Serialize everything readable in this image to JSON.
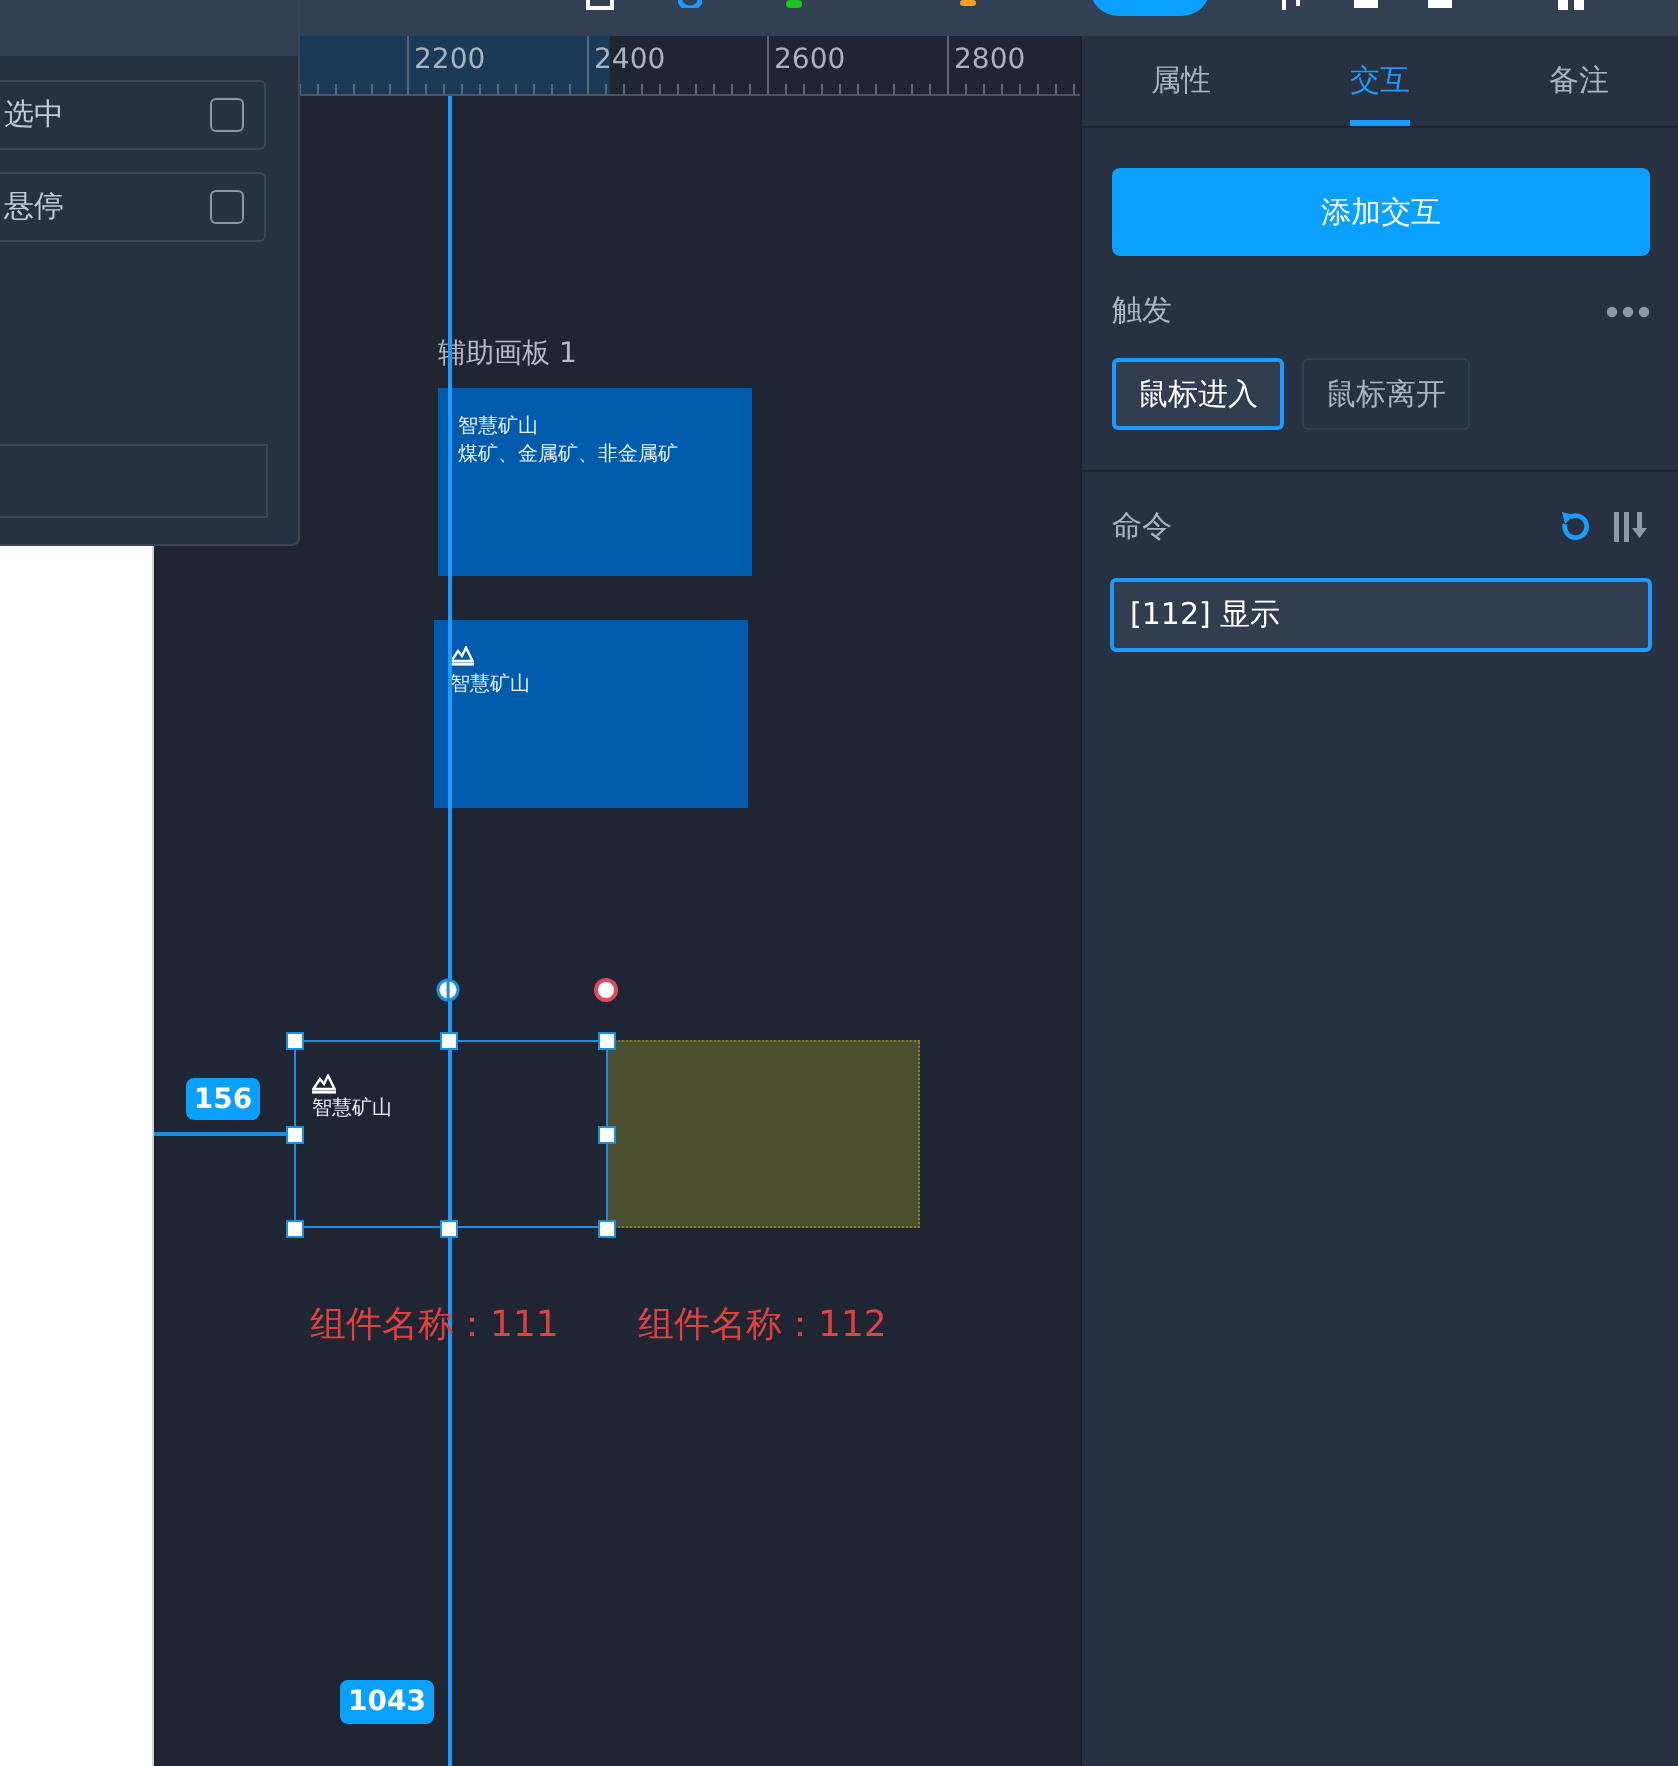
{
  "left_panel": {
    "options": [
      {
        "label": "选中",
        "checked": false
      },
      {
        "label": "悬停",
        "checked": false
      }
    ]
  },
  "ruler": {
    "labels": [
      "2200",
      "2400",
      "2600",
      "2800"
    ]
  },
  "canvas": {
    "artboard_title": "辅助画板 1",
    "cards": [
      {
        "kind": "text",
        "title": "智慧矿山",
        "subtitle": "煤矿、金属矿、非金属矿"
      },
      {
        "kind": "icon",
        "title": "智慧矿山"
      }
    ],
    "selected_component": {
      "title": "智慧矿山"
    },
    "component_labels": [
      "组件名称：111",
      "组件名称：112"
    ],
    "distance_badges": [
      "156",
      "1043"
    ]
  },
  "right_panel": {
    "tabs": [
      {
        "label": "属性",
        "selected": false
      },
      {
        "label": "交互",
        "selected": true
      },
      {
        "label": "备注",
        "selected": false
      }
    ],
    "add_button": "添加交互",
    "trigger_title": "触发",
    "triggers": [
      {
        "label": "鼠标进入",
        "selected": true
      },
      {
        "label": "鼠标离开",
        "selected": false
      }
    ],
    "command_title": "命令",
    "command": {
      "value": "[112] 显示"
    }
  }
}
